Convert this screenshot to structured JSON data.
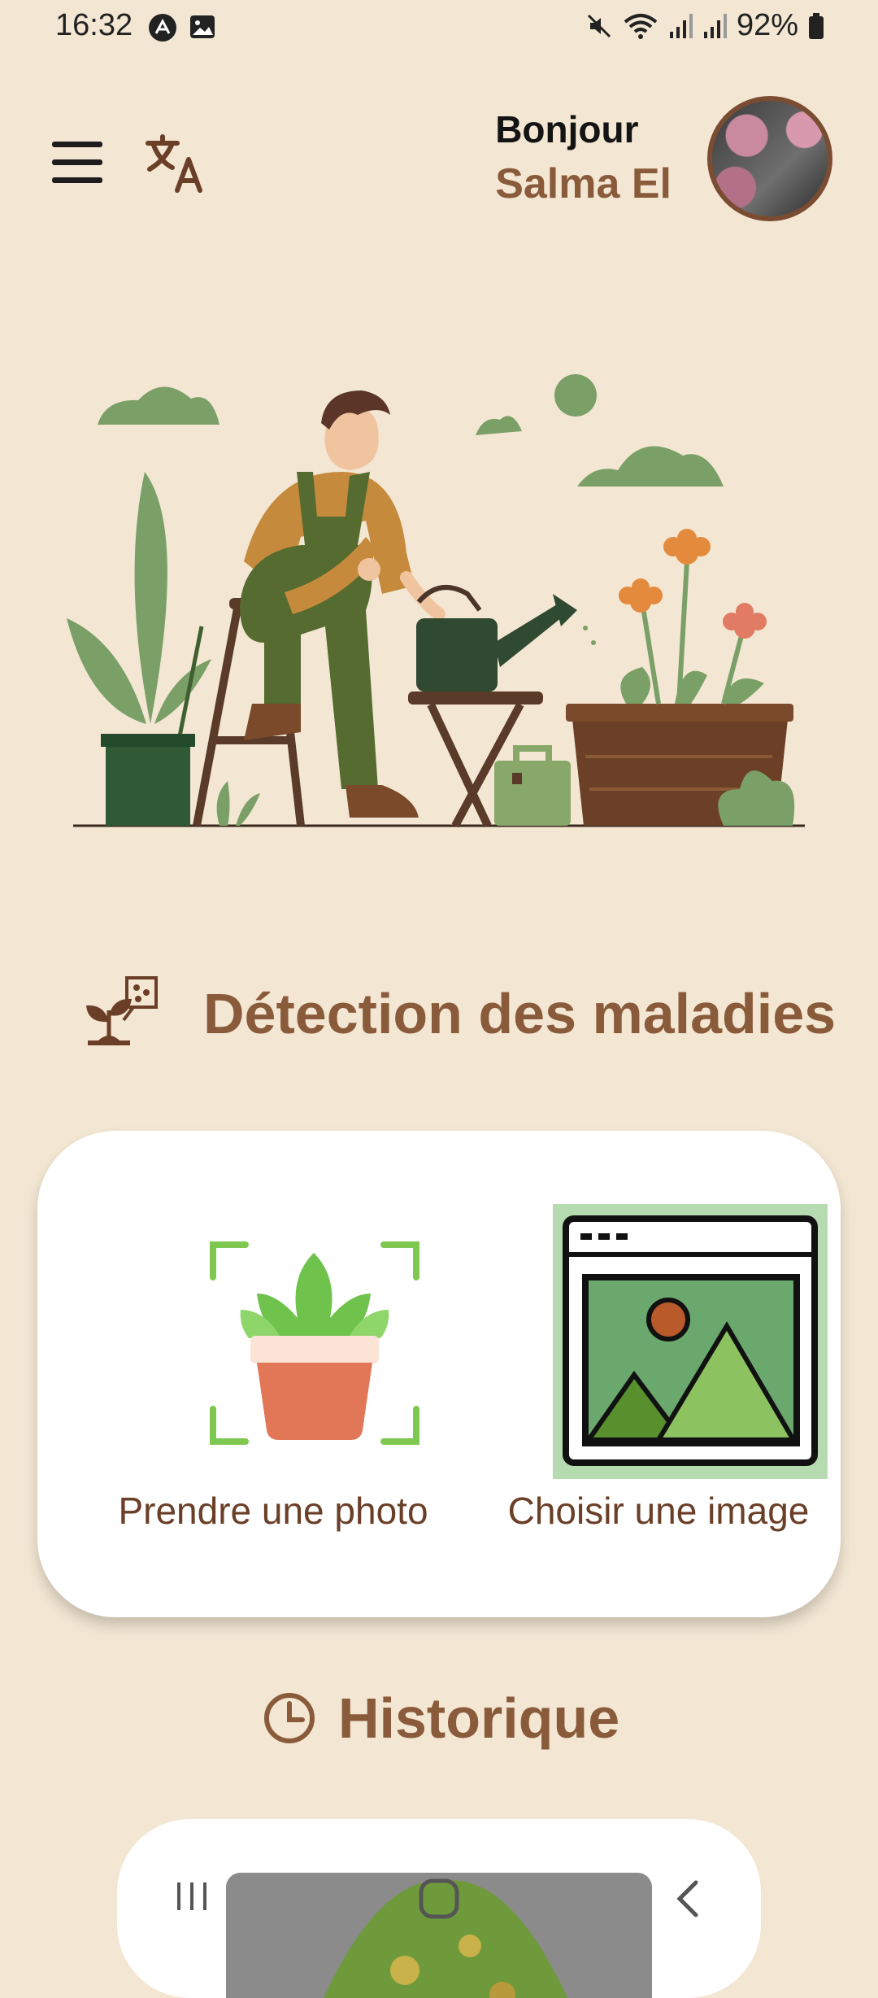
{
  "status_bar": {
    "time": "16:32",
    "battery": "92%"
  },
  "header": {
    "greeting": "Bonjour",
    "user_name": "Salma El"
  },
  "detection": {
    "title": "Détection des maladies",
    "take_photo_label": "Prendre une photo",
    "choose_image_label": "Choisir une image"
  },
  "history": {
    "title": "Historique"
  },
  "colors": {
    "background": "#f3e6d3",
    "accent_brown": "#8a5b3b",
    "card": "#ffffff",
    "green": "#7aa067"
  }
}
